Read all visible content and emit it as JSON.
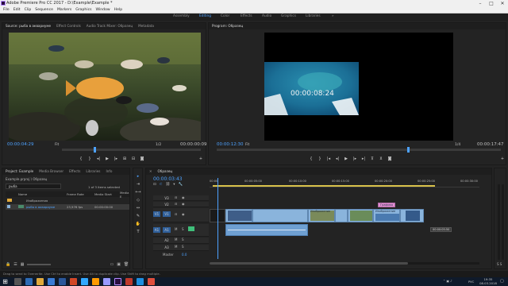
{
  "app": {
    "title": "Adobe Premiere Pro CC 2017 - D:\\Example\\Example *",
    "window_controls": [
      "–",
      "□",
      "✕"
    ]
  },
  "menu": [
    "File",
    "Edit",
    "Clip",
    "Sequence",
    "Markers",
    "Graphics",
    "Window",
    "Help"
  ],
  "workspaces": {
    "items": [
      "Assembly",
      "Editing",
      "Color",
      "Effects",
      "Audio",
      "Graphics",
      "Libraries"
    ],
    "active": "Editing",
    "more": "»"
  },
  "source_panel": {
    "tabs": [
      "Source: рыба в аквариуме",
      "Effect Controls",
      "Audio Track Mixer: Образец",
      "Metadata"
    ],
    "timecode_current": "00:00:04:29",
    "zoom": "Fit",
    "resolution": "1/2",
    "timecode_duration": "00:00:00:09"
  },
  "program_panel": {
    "tab": "Program: Образец",
    "timecode_current": "00:00:12:30",
    "zoom": "Fit",
    "resolution": "1/4",
    "timecode_duration": "00:00:17:47",
    "overlay_timecode": "00:00:08:24"
  },
  "project_panel": {
    "tabs": [
      "Project: Example",
      "Media Browser",
      "Effects",
      "Libraries",
      "Info"
    ],
    "path": "Example.prproj \\ Образец",
    "search_value": "рыба",
    "selection_info": "1 of 3 items selected",
    "columns": [
      "Name",
      "Frame Rate",
      "Media Start",
      "Media E"
    ],
    "rows": [
      {
        "name": "Изображения",
        "fps": "",
        "start": ""
      },
      {
        "name": "рыба в аквариуме",
        "fps": "23,976 fps",
        "start": "00:00:00:00"
      }
    ]
  },
  "timeline": {
    "tab": "Образец",
    "timecode": "00:00:03:43",
    "ruler": [
      "00:00",
      "00:00:05:00",
      "00:00:10:00",
      "00:00:15:00",
      "00:00:20:00",
      "00:00:25:00",
      "00:00:30:00"
    ],
    "tracks": [
      "V3",
      "V2",
      "V1",
      "A1",
      "A2",
      "A3"
    ],
    "source_patch": [
      "V1",
      "A1"
    ],
    "clip_labels": [
      "Изображение",
      "Изображение",
      "Графика"
    ],
    "tooltip": "00:00:05:50",
    "master": "Master",
    "master_value": "0.0"
  },
  "status_bar": "Drag to send to Overwrite. Use Ctrl to enable Insert. Use Alt to duplicate clip. Use Shift to drag multiple.",
  "taskbar": {
    "lang": "РУС",
    "time": "19:35",
    "date": "08.03.2018"
  },
  "colors": {
    "accent": "#4da2ff",
    "video_clip": "#8ab4dc",
    "audio_clip": "#6fa0d2",
    "label_pink": "#e28fd2",
    "playhead": "#4da2ff"
  }
}
